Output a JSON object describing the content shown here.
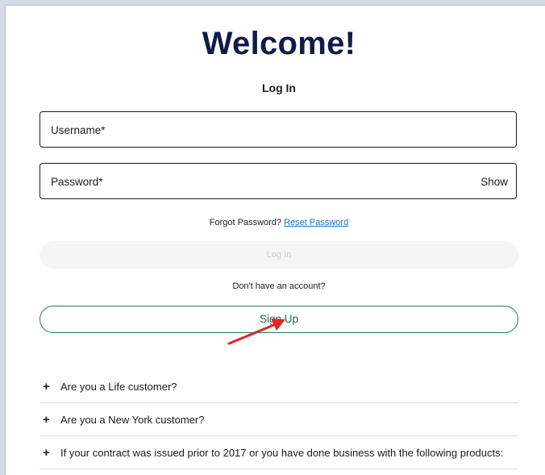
{
  "header": {
    "welcome": "Welcome!",
    "subtitle": "Log In"
  },
  "form": {
    "username_label": "Username*",
    "password_label": "Password*",
    "show_label": "Show",
    "forgot_text": "Forgot Password?",
    "reset_link": "Reset Password",
    "login_button": "Log In",
    "no_account_text": "Don't have an account?",
    "signup_button": "Sign Up"
  },
  "faq": {
    "items": [
      {
        "label": "Are you a Life customer?"
      },
      {
        "label": "Are you a New York customer?"
      },
      {
        "label": "If your contract was issued prior to 2017 or you have done business with the following products:"
      }
    ],
    "expand_symbol": "+"
  },
  "colors": {
    "heading": "#121a4a",
    "signup_border": "#1f7a5c",
    "link": "#1a6fbf",
    "annotation_arrow": "#e02424"
  },
  "icons": {
    "expand": "plus-icon",
    "annotation": "arrow-icon"
  }
}
